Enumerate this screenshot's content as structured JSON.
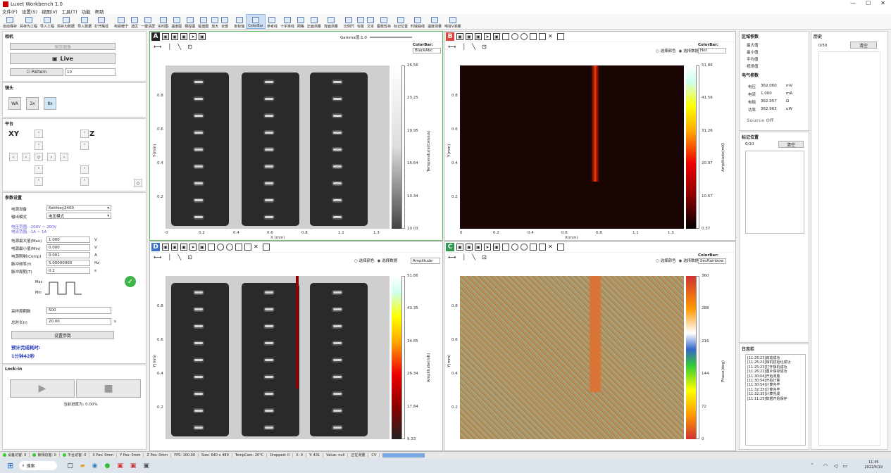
{
  "app": {
    "title": "Luxet Workbench 1.0",
    "window_controls": [
      "—",
      "☐",
      "✕"
    ]
  },
  "menu": [
    "文件(F)",
    "设置(S)",
    "视图(V)",
    "工具(T)",
    "功能",
    "帮助"
  ],
  "toolbar": [
    "自动保存",
    "另存为工程",
    "导入工程",
    "另存为数据",
    "导入数据",
    "打开路径",
    "电容暖宁",
    "选区",
    "一键清屏",
    "实时图",
    "温度图",
    "相控图",
    "幅值图",
    "放大",
    "全部",
    "坐标轴",
    "ColorBar",
    "参考线",
    "十字准线",
    "网格",
    "正面测量",
    "背面测量",
    "比例尺",
    "标签",
    "文本",
    "图像暂存",
    "标记位置",
    "时域曲线",
    "温度测量",
    "电容V测量"
  ],
  "left": {
    "camera": {
      "title": "相机",
      "btn_top": "保存图像",
      "live": "Live",
      "pattern_label": "Pattern",
      "pattern_value": "10"
    },
    "lens": {
      "title": "镜头",
      "items": [
        "WA",
        "3x",
        "8x"
      ]
    },
    "stage": {
      "title": "平台",
      "xy": "XY",
      "z": "Z"
    },
    "params": {
      "title": "参数设置",
      "rows": [
        {
          "label": "电源设备",
          "value": "Keithley2400"
        },
        {
          "label": "输出模式",
          "value": "电压模式"
        }
      ],
      "range_note": "电压范围: -200V ~ 200V\n电流范围: -1A ~ 1A",
      "rows2": [
        {
          "label": "电源最大值(Max)",
          "value": "1.000",
          "unit": "V"
        },
        {
          "label": "电源最小值(Min)",
          "value": "0.000",
          "unit": "V"
        },
        {
          "label": "电源限制(Comp)",
          "value": "0.001",
          "unit": "A"
        },
        {
          "label": "脉冲频率(f)",
          "value": "5.00000000",
          "unit": "Hz"
        },
        {
          "label": "脉冲周期(T)",
          "value": "0.2",
          "unit": "s"
        }
      ],
      "max": "Max",
      "min": "Min",
      "rows3": [
        {
          "label": "采样周期数",
          "value": "500"
        },
        {
          "label": "总时长(t)",
          "value": "20.00",
          "unit": "s"
        }
      ],
      "set_btn": "设置参数",
      "estimate_label": "预计完成耗时:",
      "estimate_value": "1分钟42秒"
    },
    "lockin": {
      "title": "Lock-in",
      "progress_label": "当前进度为: 0.00%",
      "progress": 0
    }
  },
  "quads": {
    "A": {
      "badge": "A",
      "badge_color": "#222222",
      "gamma_label": "Gamma值:1.0",
      "colorbar_label": "ColorBar:",
      "colormap": "BlackAbc",
      "ylabel": "Temperature(Celsius)",
      "cbar_ticks": [
        "26.56",
        "23.25",
        "19.95",
        "16.64",
        "13.34",
        "10.03"
      ],
      "yaxis": "Y(mm)",
      "xaxis": "X (mm)",
      "yticks": [
        "0.8",
        "0.6",
        "0.4",
        "0.2"
      ],
      "xticks": [
        "0",
        "0.2",
        "0.4",
        "0.6",
        "0.8",
        "1.1",
        "1.3"
      ]
    },
    "B": {
      "badge": "B",
      "badge_color": "#e0443a",
      "radio1": "选择颜色",
      "radio2": "选择数据",
      "colorbar_label": "ColorBar:",
      "colormap": "Hot",
      "ylabel": "Amplitude(mK)",
      "cbar_ticks": [
        "51.86",
        "41.56",
        "31.26",
        "20.97",
        "10.67",
        "0.37"
      ],
      "yaxis": "Y(mm)",
      "xaxis": "X(mm)",
      "yticks": [
        "0.8",
        "0.6",
        "0.4",
        "0.2"
      ],
      "xticks": [
        "0",
        "0.2",
        "0.4",
        "0.6",
        "0.8",
        "1.1",
        "1.3"
      ]
    },
    "D": {
      "badge": "D",
      "badge_color": "#3a6fc9",
      "radio1": "选择颜色",
      "radio2": "选择数据",
      "data_select": "Amplitude",
      "ylabel": "Amplitude(mK)",
      "cbar_ticks": [
        "51.86",
        "43.35",
        "34.85",
        "26.34",
        "17.84",
        "9.33"
      ],
      "yaxis": "Y(mm)",
      "yticks": [
        "0.8",
        "0.6",
        "0.4",
        "0.2"
      ]
    },
    "C": {
      "badge": "C",
      "badge_color": "#2e9a4e",
      "radio1": "选择颜色",
      "radio2": "选择数据",
      "colorbar_label": "ColorBar:",
      "colormap": "SecRainbow",
      "ylabel": "Phase(deg)",
      "cbar_ticks": [
        "360",
        "288",
        "216",
        "144",
        "72",
        "0"
      ],
      "yaxis": "Y(mm)",
      "yticks": [
        "0.8",
        "0.6",
        "0.4",
        "0.2"
      ]
    }
  },
  "right": {
    "region": {
      "title": "区域参数",
      "items": [
        "最大值",
        "最小值",
        "平均值",
        "视场值"
      ]
    },
    "elec": {
      "title": "电气参数",
      "rows": [
        {
          "label": "电压",
          "value": "362.060",
          "unit": "mV"
        },
        {
          "label": "电流",
          "value": "1.000",
          "unit": "mA"
        },
        {
          "label": "电阻",
          "value": "362.957",
          "unit": "Ω"
        },
        {
          "label": "功率",
          "value": "362.963",
          "unit": "uW"
        }
      ],
      "source": "Source Off"
    },
    "marks": {
      "title": "标记位置",
      "count": "0/10",
      "clear": "清空"
    },
    "log": {
      "title": "日志栏",
      "lines": [
        "[11:25:23]启动成功",
        "[11:25:23]相机初始化成功",
        "[11:25:23]打开相机成功",
        "[11:26:22]图片保存成功",
        "[11:30:04]开始测量",
        "[11:30:54]开始计算",
        "[11:30:54]计算完毕",
        "[11:32:35]计算完毕",
        "[11:32:35]计算完成",
        "[11:11:25]数据开始保存"
      ]
    },
    "history": {
      "title": "历史",
      "count": "0/50",
      "clear": "清空"
    }
  },
  "status": {
    "items": [
      "设备访客: 0",
      "锁相访客: 0",
      "平台访客: 0",
      "X Pos: 0mm",
      "Y Pos: 0mm",
      "Z Pos: 0mm",
      "FPS: 100.00",
      "Size: 640 x 480",
      "TempCam: 20°C",
      "Dropped: 0",
      "X: 0",
      "Y: 431",
      "Value: null",
      "正在测量",
      "CV"
    ]
  },
  "taskbar": {
    "search": "搜索",
    "time": "11:35",
    "date": "2022/4/19"
  }
}
